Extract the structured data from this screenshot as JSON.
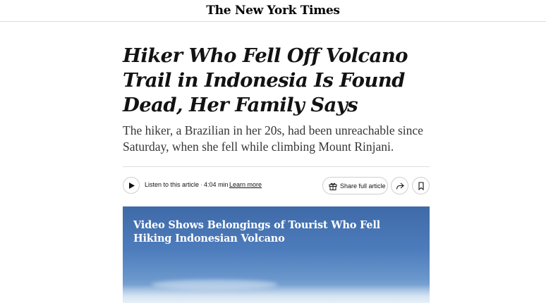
{
  "masthead": {
    "logo_text": "The New York Times"
  },
  "article": {
    "headline": "Hiker Who Fell Off Volcano Trail in Indonesia Is Found Dead, Her Family Says",
    "summary": "The hiker, a Brazilian in her 20s, had been unreachable since Saturday, when she fell while climbing Mount Rinjani."
  },
  "toolbar": {
    "listen_label": "Listen to this article",
    "separator": "·",
    "duration": "4:04 min",
    "learn_more": "Learn more",
    "share_full_article": "Share full article",
    "icons": {
      "play": "play-icon",
      "gift": "gift-icon",
      "share": "share-arrow-icon",
      "bookmark": "bookmark-icon"
    }
  },
  "video": {
    "title": "Video Shows Belongings of Tourist Who Fell Hiking Indonesian Volcano"
  }
}
